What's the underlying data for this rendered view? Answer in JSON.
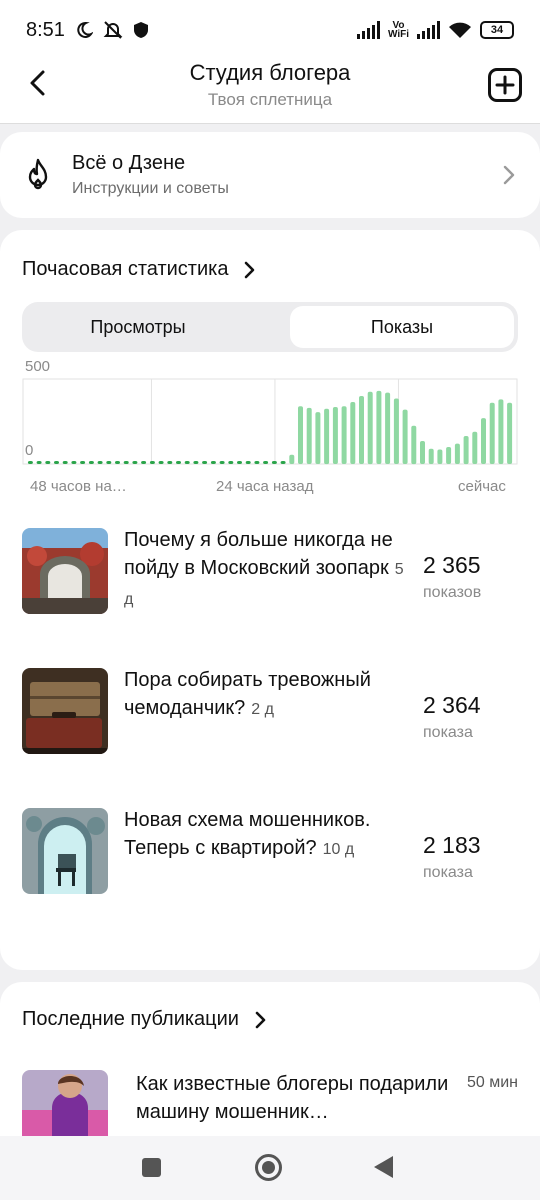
{
  "status_bar": {
    "time": "8:51",
    "vo": "Vo",
    "wifi_label": "WiFi",
    "battery": "34"
  },
  "header": {
    "title": "Студия блогера",
    "subtitle": "Твоя сплетница"
  },
  "zen_card": {
    "title": "Всё о Дзене",
    "subtitle": "Инструкции и советы"
  },
  "stats": {
    "title": "Почасовая статистика",
    "tabs": [
      "Просмотры",
      "Показы"
    ],
    "selected_tab": "Показы"
  },
  "chart_data": {
    "type": "bar",
    "y_ticks": [
      "500",
      "0"
    ],
    "ylim": [
      0,
      500
    ],
    "x_tick_labels": [
      "48 часов на…",
      "24 часа назад",
      "сейчас"
    ],
    "colors": {
      "past": "#2aa44a",
      "recent": "#8fd8a2"
    },
    "values": [
      4,
      4,
      4,
      4,
      4,
      4,
      4,
      4,
      4,
      4,
      4,
      4,
      4,
      4,
      4,
      4,
      4,
      4,
      4,
      4,
      4,
      4,
      4,
      4,
      4,
      4,
      4,
      4,
      4,
      4,
      55,
      340,
      330,
      305,
      325,
      335,
      340,
      365,
      400,
      425,
      430,
      420,
      385,
      320,
      225,
      135,
      90,
      85,
      100,
      120,
      165,
      190,
      270,
      360,
      380,
      360
    ],
    "recent_start_index": 30,
    "grid": true
  },
  "top_posts": [
    {
      "title": "Почему я больше никогда не пойду в Московский зоопарк",
      "age": "5 д",
      "count": "2 365",
      "unit": "показов"
    },
    {
      "title": "Пора собирать тревожный чемоданчик?",
      "age": "2 д",
      "count": "2 364",
      "unit": "показа"
    },
    {
      "title": "Новая схема мошенников. Теперь с квартирой?",
      "age": "10 д",
      "count": "2 183",
      "unit": "показа"
    }
  ],
  "recent": {
    "title": "Последние публикации",
    "item": {
      "title": "Как известные блогеры подарили машину мошенник…",
      "time": "50 мин"
    }
  },
  "icons": {
    "back": "back-arrow-icon",
    "add": "add-square-icon",
    "zen": "fire-icon",
    "chevron": "chevron-right-icon"
  }
}
